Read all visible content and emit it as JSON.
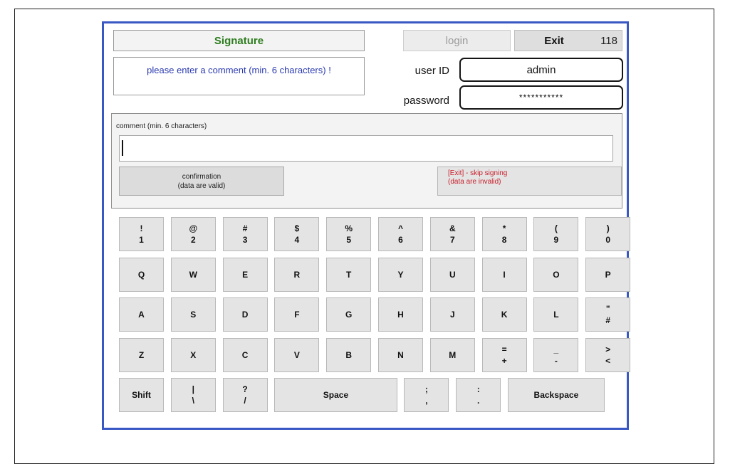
{
  "dialog": {
    "title": "Signature",
    "message": "please enter a comment (min. 6 characters) !",
    "login_label": "login",
    "exit_label": "Exit",
    "exit_count": "118",
    "user_id_label": "user ID",
    "user_id_value": "admin",
    "password_label": "password",
    "password_value": "***********",
    "comment_label": "comment (min. 6 characters)",
    "comment_value": "",
    "confirm_line1": "confirmation",
    "confirm_line2": "(data are valid)",
    "skip_line1": "[Exit] - skip signing",
    "skip_line2": "(data are invalid)"
  },
  "keyboard": {
    "rows": [
      [
        {
          "top": "!",
          "bottom": "1"
        },
        {
          "top": "@",
          "bottom": "2"
        },
        {
          "top": "#",
          "bottom": "3"
        },
        {
          "top": "$",
          "bottom": "4"
        },
        {
          "top": "%",
          "bottom": "5"
        },
        {
          "top": "^",
          "bottom": "6"
        },
        {
          "top": "&",
          "bottom": "7"
        },
        {
          "top": "*",
          "bottom": "8"
        },
        {
          "top": "(",
          "bottom": "9"
        },
        {
          "top": ")",
          "bottom": "0"
        }
      ],
      [
        {
          "label": "Q"
        },
        {
          "label": "W"
        },
        {
          "label": "E"
        },
        {
          "label": "R"
        },
        {
          "label": "T"
        },
        {
          "label": "Y"
        },
        {
          "label": "U"
        },
        {
          "label": "I"
        },
        {
          "label": "O"
        },
        {
          "label": "P"
        }
      ],
      [
        {
          "label": "A"
        },
        {
          "label": "S"
        },
        {
          "label": "D"
        },
        {
          "label": "F"
        },
        {
          "label": "G"
        },
        {
          "label": "H"
        },
        {
          "label": "J"
        },
        {
          "label": "K"
        },
        {
          "label": "L"
        },
        {
          "top": "\"",
          "bottom": "#"
        }
      ],
      [
        {
          "label": "Z"
        },
        {
          "label": "X"
        },
        {
          "label": "C"
        },
        {
          "label": "V"
        },
        {
          "label": "B"
        },
        {
          "label": "N"
        },
        {
          "label": "M"
        },
        {
          "top": "=",
          "bottom": "+"
        },
        {
          "top": "_",
          "bottom": "-"
        },
        {
          "top": ">",
          "bottom": "<"
        }
      ],
      [
        {
          "label": "Shift"
        },
        {
          "top": "|",
          "bottom": "\\"
        },
        {
          "top": "?",
          "bottom": "/"
        },
        {
          "label": "Space"
        },
        {
          "top": ";",
          "bottom": ","
        },
        {
          "top": ":",
          "bottom": "."
        },
        {
          "label": "Backspace"
        }
      ]
    ]
  },
  "colors": {
    "dialog_border": "#3a58c4",
    "title_text": "#2e7d1f",
    "message_text": "#2b3bb0",
    "skip_text": "#c8202c"
  }
}
